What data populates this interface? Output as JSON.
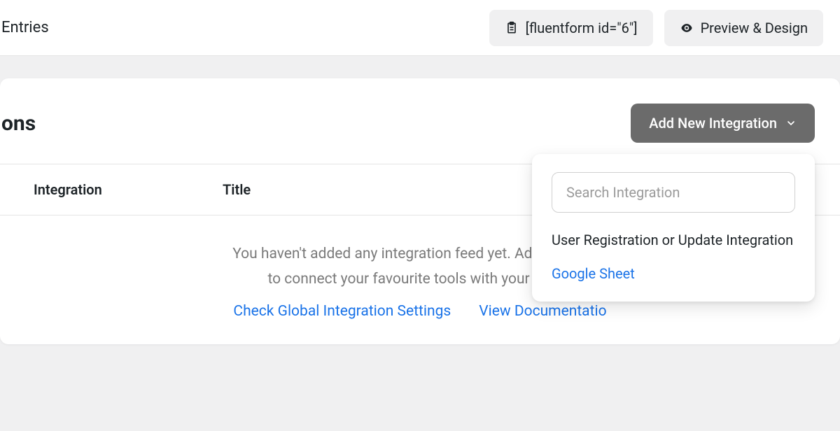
{
  "topbar": {
    "entries_label": "Entries",
    "shortcode": "[fluentform id=\"6\"]",
    "preview_label": "Preview & Design"
  },
  "panel": {
    "title_suffix": "ons",
    "add_button": "Add New Integration"
  },
  "table": {
    "columns": {
      "integration": "Integration",
      "title": "Title"
    }
  },
  "empty": {
    "line1": "You haven't added any integration feed yet. Add new integ",
    "line2": "to connect your favourite tools with your forms",
    "link_settings": "Check Global Integration Settings",
    "link_docs": "View Documentatio"
  },
  "dropdown": {
    "search_placeholder": "Search Integration",
    "items": [
      "User Registration or Update Integration",
      "Google Sheet"
    ]
  }
}
